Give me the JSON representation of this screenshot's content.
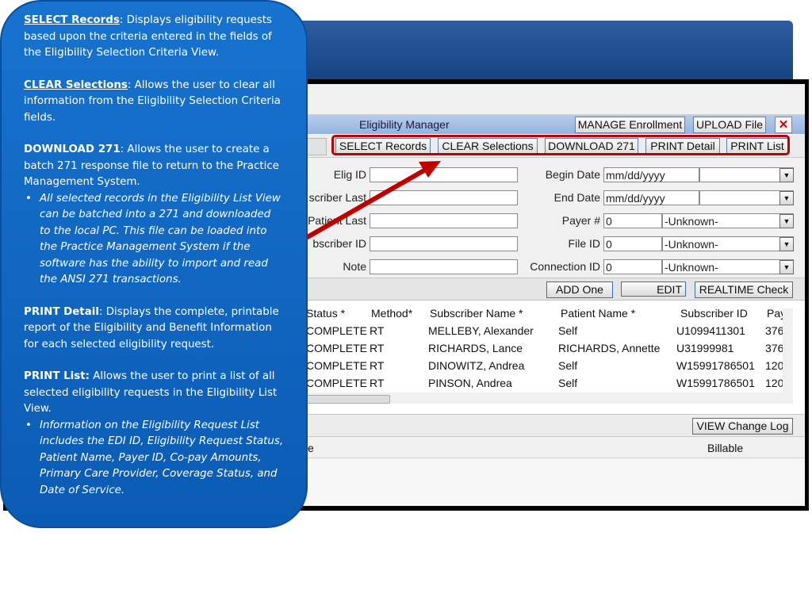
{
  "app": {
    "title": "Eligibility Manager",
    "header_buttons": {
      "manage": "MANAGE Enrollment",
      "upload": "UPLOAD File",
      "close": "✕"
    },
    "toolbar": {
      "select": "SELECT Records",
      "clear": "CLEAR Selections",
      "download": "DOWNLOAD 271",
      "print_detail": "PRINT Detail",
      "print_list": "PRINT List"
    },
    "criteria": {
      "left": [
        {
          "label": "Elig ID",
          "value": ""
        },
        {
          "label": "scriber Last",
          "value": ""
        },
        {
          "label": "Patient Last",
          "value": ""
        },
        {
          "label": "bscriber ID",
          "value": ""
        },
        {
          "label": "Note",
          "value": ""
        }
      ],
      "right": [
        {
          "label": "Begin Date",
          "value": "mm/dd/yyyy",
          "extra": ""
        },
        {
          "label": "End Date",
          "value": "mm/dd/yyyy",
          "extra": ""
        },
        {
          "label": "Payer #",
          "value": "0",
          "extra": "-Unknown-"
        },
        {
          "label": "File ID",
          "value": "0",
          "extra": "-Unknown-"
        },
        {
          "label": "Connection ID",
          "value": "0",
          "extra": "-Unknown-"
        }
      ]
    },
    "actions": {
      "add": "ADD One",
      "edit": "EDIT",
      "realtime": "REALTIME Check"
    },
    "grid": {
      "headers": [
        "Status *",
        "Method*",
        "Subscriber Name *",
        "Patient Name *",
        "Subscriber ID",
        "Pay"
      ],
      "rows": [
        [
          "COMPLETE",
          "RT",
          "MELLEBY, Alexander",
          "Self",
          "U1099411301",
          "376"
        ],
        [
          "COMPLETE",
          "RT",
          "RICHARDS, Lance",
          "RICHARDS, Annette",
          "U31999981",
          "376"
        ],
        [
          "COMPLETE",
          "RT",
          "DINOWITZ, Andrea",
          "Self",
          "W15991786501",
          "120"
        ],
        [
          "COMPLETE",
          "RT",
          "PINSON, Andrea",
          "Self",
          "W15991786501",
          "120"
        ]
      ]
    },
    "log_button": "VIEW Change Log",
    "bottom_headers": {
      "left": "e",
      "billable": "Billable"
    }
  },
  "callout": {
    "select": {
      "term": "SELECT Records",
      "text": ": Displays eligibility requests based upon the criteria entered in the fields of the Eligibility Selection Criteria View."
    },
    "clear": {
      "term": "CLEAR Selections",
      "text": ": Allows the user to clear all information from the Eligibility Selection Criteria fields."
    },
    "download": {
      "term": "DOWNLOAD 271",
      "text": ": Allows the user to create a batch 271 response file to return to the Practice Management System.",
      "bullet": "All selected records in the Eligibility List View can be batched into a 271 and downloaded to the local PC. This file can be loaded into the Practice Management System if the software has the ability to import and read the ANSI 271 transactions."
    },
    "print_detail": {
      "term": "PRINT Detail",
      "text": ": Displays the complete, printable report of the Eligibility and Benefit Information for each selected eligibility request."
    },
    "print_list": {
      "term": "PRINT List:",
      "text": " Allows the user to print a list of all selected eligibility requests in the Eligibility List View.",
      "bullet": "Information on the Eligibility Request List includes the EDI ID, Eligibility Request Status, Patient Name, Payer ID, Co-pay Amounts, Primary Care Provider, Coverage Status, and Date of Service."
    }
  },
  "colors": {
    "callout_blue": "#1773cf",
    "highlight_red": "#c00000",
    "banner_blue": "#1f4f92"
  }
}
